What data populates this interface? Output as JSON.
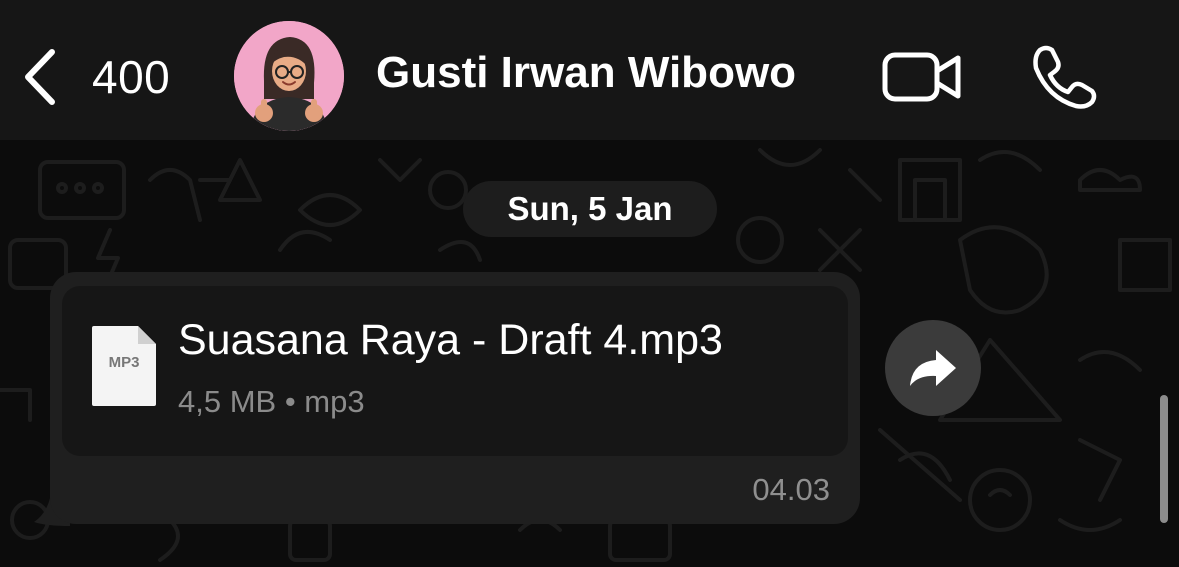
{
  "header": {
    "back_count": "400",
    "contact_name": "Gusti Irwan Wibowo",
    "avatar_bg": "#f2a6c8",
    "icons": {
      "back": "chevron-left-icon",
      "video": "video-camera-icon",
      "call": "phone-icon"
    }
  },
  "chat": {
    "date_separator": "Sun, 5 Jan",
    "message": {
      "file_type_label": "MP3",
      "file_name": "Suasana Raya - Draft 4.mp3",
      "file_meta": "4,5 MB • mp3",
      "time": "04.03",
      "forward_icon": "forward-arrow-icon"
    }
  },
  "colors": {
    "header_bg": "#161616",
    "bubble_bg": "#1f1f1f",
    "file_card_bg": "#161616",
    "secondary_text": "#8b8b8b"
  }
}
